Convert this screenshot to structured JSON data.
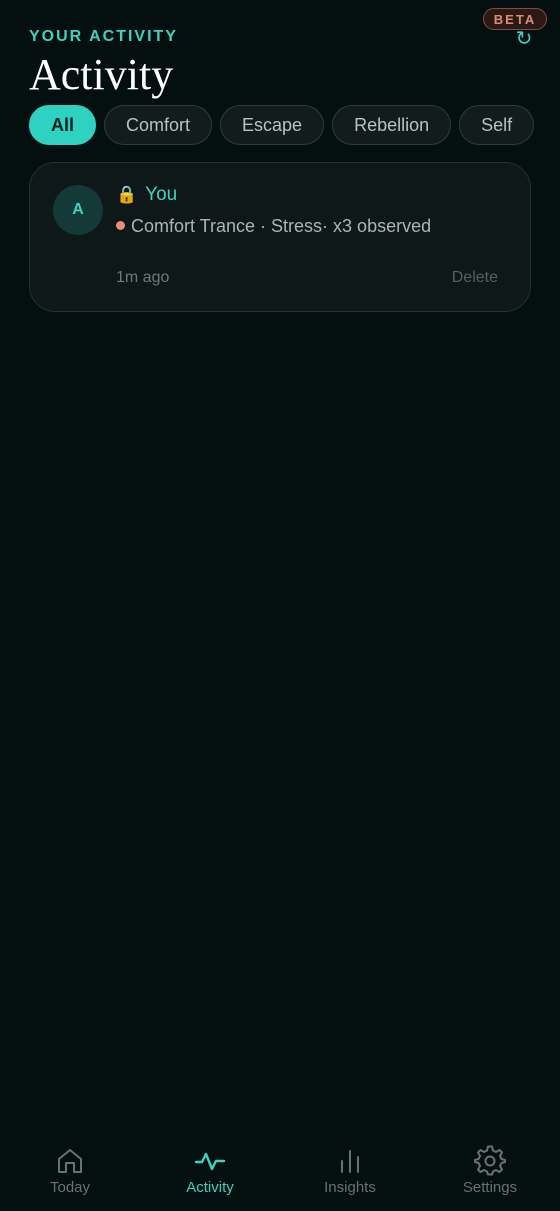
{
  "badge": "BETA",
  "refresh_icon": "↻",
  "header": {
    "eyebrow": "YOUR ACTIVITY",
    "title": "Activity"
  },
  "filters": [
    {
      "label": "All",
      "active": true
    },
    {
      "label": "Comfort",
      "active": false
    },
    {
      "label": "Escape",
      "active": false
    },
    {
      "label": "Rebellion",
      "active": false
    },
    {
      "label": "Self",
      "active": false
    }
  ],
  "entries": [
    {
      "avatar": "A",
      "lock_icon": "🔒",
      "user": "You",
      "description": "Comfort Trance · Stress· x3 observed",
      "time": "1m ago",
      "delete_label": "Delete"
    }
  ],
  "nav": [
    {
      "label": "Today",
      "icon": "home-icon",
      "active": false
    },
    {
      "label": "Activity",
      "icon": "activity-icon",
      "active": true
    },
    {
      "label": "Insights",
      "icon": "bar-chart-icon",
      "active": false
    },
    {
      "label": "Settings",
      "icon": "gear-icon",
      "active": false
    }
  ],
  "colors": {
    "accent": "#3fd1bf",
    "background": "#040f0f",
    "badge": "#e08a73",
    "status_dot": "#e88d78"
  }
}
